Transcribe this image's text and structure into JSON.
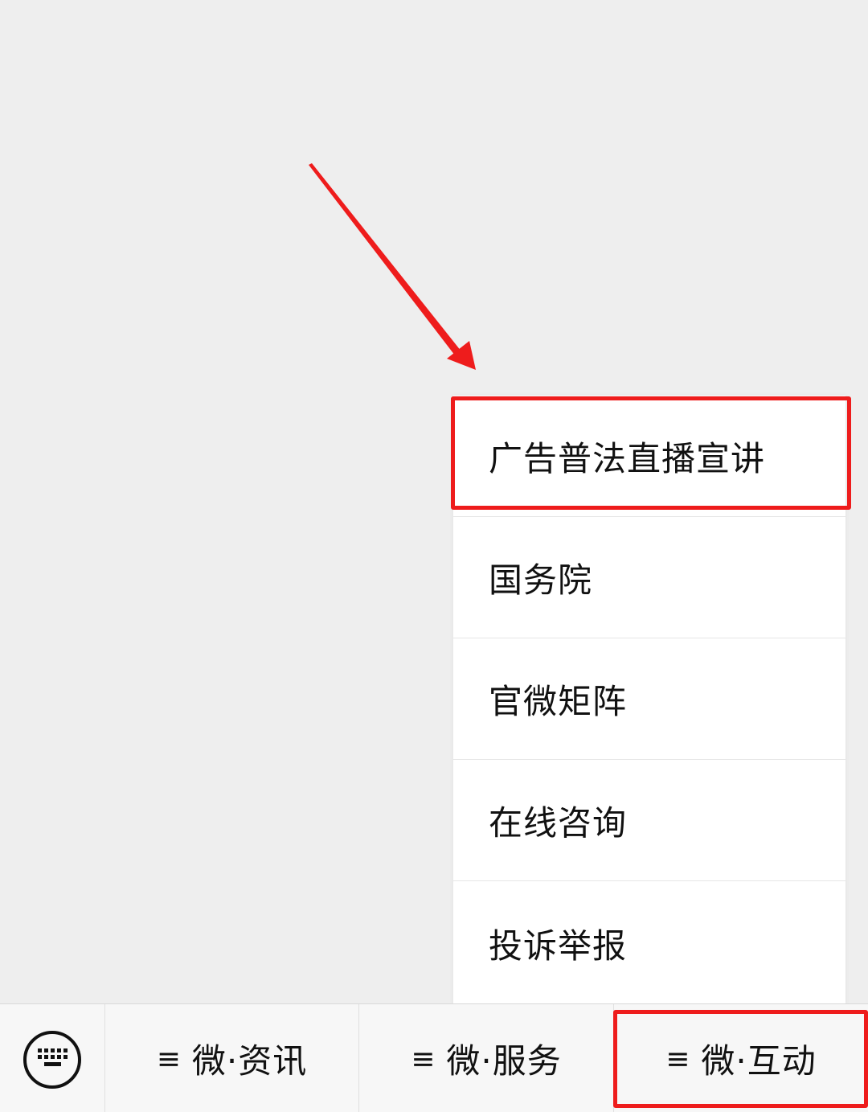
{
  "popup_menu": {
    "items": [
      {
        "label": "广告普法直播宣讲"
      },
      {
        "label": "国务院"
      },
      {
        "label": "官微矩阵"
      },
      {
        "label": "在线咨询"
      },
      {
        "label": "投诉举报"
      }
    ]
  },
  "bottom_bar": {
    "keyboard_icon": "keyboard-icon",
    "tabs": [
      {
        "icon": "≡",
        "label": "微·资讯"
      },
      {
        "icon": "≡",
        "label": "微·服务"
      },
      {
        "icon": "≡",
        "label": "微·互动"
      }
    ]
  },
  "colors": {
    "annotation": "#ee1c1c",
    "background": "#eeeeee",
    "menu_background": "#ffffff"
  }
}
